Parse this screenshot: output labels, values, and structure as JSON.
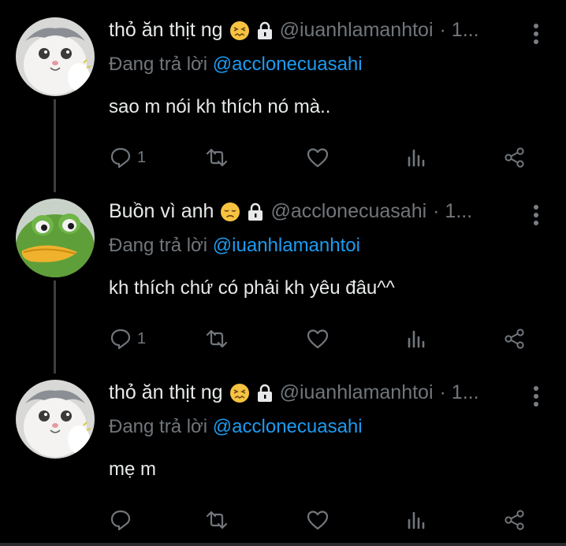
{
  "thread": [
    {
      "name": "thỏ ăn thịt ng",
      "name_emoji": "confounded-face",
      "handle": "@iuanhlamanhtoi",
      "time": "· 1...",
      "reply_prefix": "Đang trả lời",
      "reply_to": "@acclonecuasahi",
      "text": "sao m nói kh thích nó mà..",
      "reply_count": "1",
      "avatar": "cat-avatar"
    },
    {
      "name": "Buồn vì anh",
      "name_emoji": "disappointed-face",
      "handle": "@acclonecuasahi",
      "time": "· 1...",
      "reply_prefix": "Đang trả lời",
      "reply_to": "@iuanhlamanhtoi",
      "text": "kh thích chứ có phải kh yêu đâu^^",
      "reply_count": "1",
      "avatar": "frog-avatar"
    },
    {
      "name": "thỏ ăn thịt ng",
      "name_emoji": "confounded-face",
      "handle": "@iuanhlamanhtoi",
      "time": "· 1...",
      "reply_prefix": "Đang trả lời",
      "reply_to": "@acclonecuasahi",
      "text": "mẹ m",
      "reply_count": "",
      "avatar": "cat-avatar"
    }
  ],
  "colors": {
    "background": "#000000",
    "text": "#e7e9ea",
    "muted": "#71767b",
    "mention": "#1d9bf0",
    "thread_line": "#3b3f44"
  }
}
